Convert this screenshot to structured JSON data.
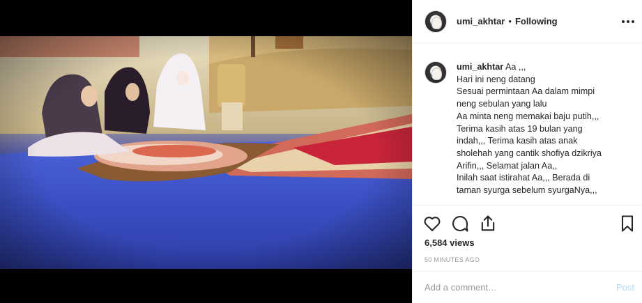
{
  "post": {
    "image_alt": "",
    "username": "umi_akhtar",
    "separator": "•",
    "follow_status": "Following"
  },
  "caption": {
    "username": "umi_akhtar",
    "lines": [
      "Aa ,,,",
      "Hari ini neng datang",
      "Sesuai permintaan Aa dalam mimpi",
      "neng sebulan yang lalu",
      "Aa minta neng memakai baju putih,,,",
      "Terima kasih atas 19 bulan yang",
      "indah,,, Terima kasih atas anak",
      "sholehah yang cantik shofiya dzikriya",
      "Arifin,,, Selamat jalan Aa,,",
      "Inilah saat istirahat Aa,,, Berada di",
      "taman syurga sebelum syurgaNya,,,"
    ]
  },
  "stats": {
    "views": "6,584 views",
    "time": "50 MINUTES AGO"
  },
  "comment": {
    "placeholder": "Add a comment…",
    "post_label": "Post"
  },
  "icons": {
    "like": "heart-icon",
    "comment": "comment-icon",
    "share": "share-icon",
    "save": "bookmark-icon",
    "more": "more-options-icon"
  },
  "colors": {
    "link_disabled": "#b3dbff",
    "muted": "#999999",
    "text": "#262626"
  }
}
